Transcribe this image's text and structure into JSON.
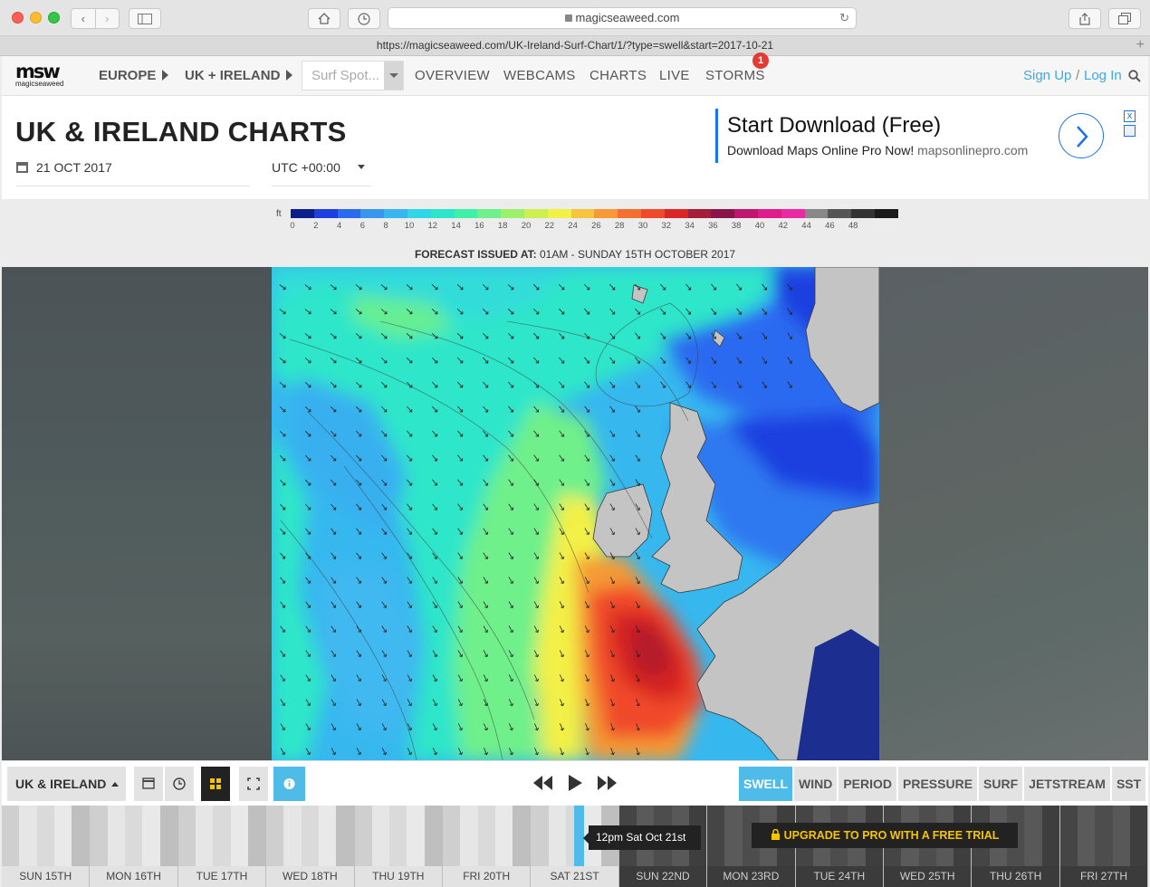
{
  "browser": {
    "address_host": "magicseaweed.com",
    "full_url": "https://magicseaweed.com/UK-Ireland-Surf-Chart/1/?type=swell&start=2017-10-21"
  },
  "nav": {
    "logo_mark": "msw",
    "logo_word": "magicseaweed",
    "breadcrumbs": [
      "EUROPE",
      "UK + IRELAND"
    ],
    "spot_placeholder": "Surf Spot...",
    "menu": [
      "OVERVIEW",
      "WEBCAMS",
      "CHARTS",
      "LIVE",
      "STORMS"
    ],
    "storms_badge": "1",
    "sign_up": "Sign Up",
    "separator": "/",
    "log_in": "Log In"
  },
  "header": {
    "title": "UK & IRELAND CHARTS",
    "date": "21 OCT 2017",
    "timezone": "UTC +00:00"
  },
  "ad": {
    "headline": "Start Download (Free)",
    "text": "Download Maps Online Pro Now!",
    "domain": "mapsonlinepro.com",
    "close": "x"
  },
  "legend": {
    "unit": "ft",
    "ticks": [
      "0",
      "2",
      "4",
      "6",
      "8",
      "10",
      "12",
      "14",
      "16",
      "18",
      "20",
      "22",
      "24",
      "26",
      "28",
      "30",
      "32",
      "34",
      "36",
      "38",
      "40",
      "42",
      "44",
      "46",
      "48"
    ],
    "colors": [
      "#0a1f8c",
      "#1d3fe0",
      "#2a6af0",
      "#3895f0",
      "#39b6f0",
      "#2ed6e6",
      "#2de6c9",
      "#3ef0a8",
      "#6ff08a",
      "#9cf06a",
      "#cdf04f",
      "#f3f046",
      "#f6c43d",
      "#f59a36",
      "#f4702f",
      "#f04a2a",
      "#d92727",
      "#a51d3b",
      "#8a1549",
      "#c0166e",
      "#e01b8c",
      "#ea2aa4",
      "#888888",
      "#555555",
      "#333333",
      "#1a1a1a"
    ],
    "issued_label": "FORECAST ISSUED AT:",
    "issued_value": "01AM - SUNDAY 15TH OCTOBER 2017"
  },
  "toolbar": {
    "region": "UK & IRELAND",
    "modes": [
      "SWELL",
      "WIND",
      "PERIOD",
      "PRESSURE",
      "SURF",
      "JETSTREAM",
      "SST"
    ],
    "active_mode": "SWELL"
  },
  "timeline": {
    "days": [
      "SUN 15TH",
      "MON 16TH",
      "TUE 17TH",
      "WED 18TH",
      "THU 19TH",
      "FRI 20TH",
      "SAT 21ST",
      "SUN 22ND",
      "MON 23RD",
      "TUE 24TH",
      "WED 25TH",
      "THU 26TH",
      "FRI 27TH"
    ],
    "current_tooltip": "12pm Sat Oct 21st",
    "upgrade_text": "UPGRADE TO PRO WITH A FREE TRIAL"
  }
}
